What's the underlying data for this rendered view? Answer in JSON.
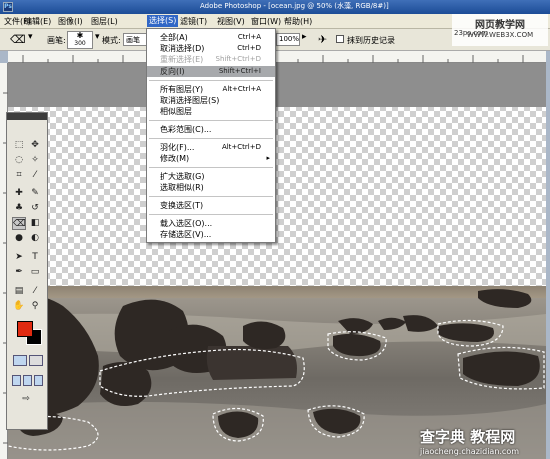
{
  "window": {
    "title": "Adobe Photoshop - [ocean.jpg @ 50% (水藻, RGB/8#)]"
  },
  "menubar": {
    "items": [
      "文件(F)",
      "编辑(E)",
      "图像(I)",
      "图层(L)",
      "选择(S)",
      "滤镜(T)",
      "视图(V)",
      "窗口(W)",
      "帮助(H)"
    ]
  },
  "options": {
    "brush_label": "画笔:",
    "brush_size": "300",
    "mode_label": "模式:",
    "mode_value": "画笔",
    "zoom_value": "100%",
    "erase_history_label": "抹到历史记录"
  },
  "watermark_top": {
    "cn": "网页教学网",
    "url": "WWW.WEB3X.COM"
  },
  "watermark_ps": "23ps.com",
  "select_menu": {
    "items": [
      {
        "label": "全部(A)",
        "shortcut": "Ctrl+A",
        "state": "normal"
      },
      {
        "label": "取消选择(D)",
        "shortcut": "Ctrl+D",
        "state": "normal"
      },
      {
        "label": "重新选择(E)",
        "shortcut": "Shift+Ctrl+D",
        "state": "disabled"
      },
      {
        "label": "反向(I)",
        "shortcut": "Shift+Ctrl+I",
        "state": "highlight"
      },
      {
        "label": "所有图层(Y)",
        "shortcut": "Alt+Ctrl+A",
        "state": "normal"
      },
      {
        "label": "取消选择图层(S)",
        "shortcut": "",
        "state": "normal"
      },
      {
        "label": "相似图层",
        "shortcut": "",
        "state": "normal"
      },
      {
        "label": "色彩范围(C)...",
        "shortcut": "",
        "state": "normal"
      },
      {
        "label": "羽化(F)...",
        "shortcut": "Alt+Ctrl+D",
        "state": "normal"
      },
      {
        "label": "修改(M)",
        "shortcut": "",
        "state": "submenu"
      },
      {
        "label": "扩大选取(G)",
        "shortcut": "",
        "state": "normal"
      },
      {
        "label": "选取相似(R)",
        "shortcut": "",
        "state": "normal"
      },
      {
        "label": "变换选区(T)",
        "shortcut": "",
        "state": "normal"
      },
      {
        "label": "载入选区(O)...",
        "shortcut": "",
        "state": "normal"
      },
      {
        "label": "存储选区(V)...",
        "shortcut": "",
        "state": "normal"
      }
    ],
    "submenu_arrow": "▸"
  },
  "watermark_bottom": {
    "big": "查字典 教程网",
    "small": "jiaocheng.chazidian.com"
  },
  "colors": {
    "foreground": "#e02a10",
    "background": "#000000",
    "menu_highlight": "#3167c6"
  }
}
